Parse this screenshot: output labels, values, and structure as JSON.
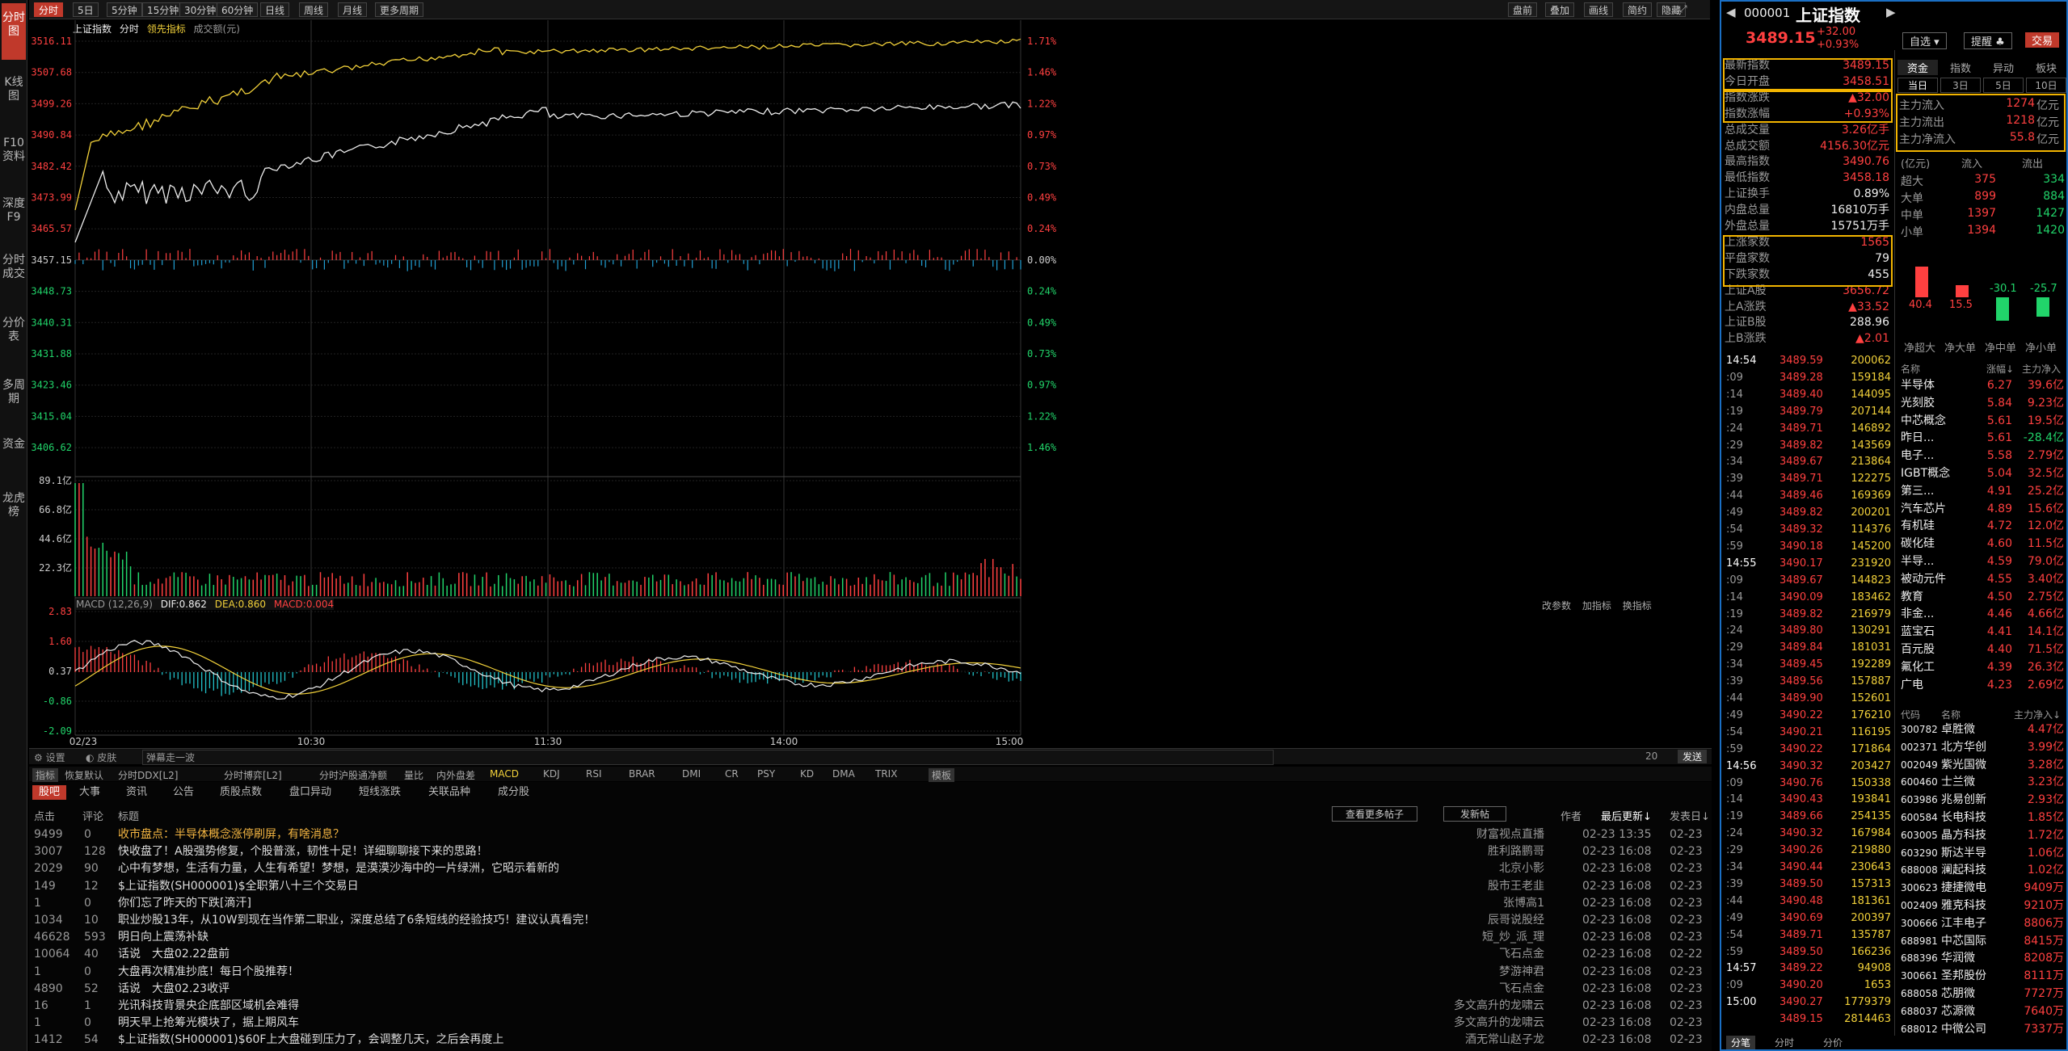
{
  "nav": [
    "分时图",
    "K线图",
    "F10资料",
    "深度F9",
    "分时成交",
    "分价表",
    "多周期",
    "资金",
    "龙虎榜"
  ],
  "toolbar": {
    "periods": [
      "分时",
      "5日",
      "5分钟",
      "15分钟",
      "30分钟",
      "60分钟",
      "日线",
      "周线",
      "月线",
      "更多周期"
    ],
    "right": [
      "盘前",
      "叠加",
      "画线",
      "简约",
      "隐藏"
    ]
  },
  "legend": {
    "name": "上证指数",
    "mode": "分时",
    "lead": "领先指标",
    "vol": "成交额(元)"
  },
  "yaxis": {
    "prices": [
      "3516.11",
      "3507.68",
      "3499.26",
      "3490.84",
      "3482.42",
      "3473.99",
      "3465.57",
      "3457.15",
      "3448.73",
      "3440.31",
      "3431.88",
      "3423.46",
      "3415.04",
      "3406.62"
    ],
    "pcts": [
      "1.71%",
      "1.46%",
      "1.22%",
      "0.97%",
      "0.73%",
      "0.49%",
      "0.24%",
      "0.00%",
      "0.24%",
      "0.49%",
      "0.73%",
      "0.97%",
      "1.22%",
      "1.46%"
    ],
    "vols": [
      "89.1亿",
      "66.8亿",
      "44.6亿",
      "22.3亿"
    ],
    "macd": [
      "2.83",
      "1.60",
      "0.37",
      "-0.86",
      "-2.09"
    ]
  },
  "xaxis": [
    "02/23",
    "10:30",
    "11:30",
    "14:00",
    "15:00"
  ],
  "macd": {
    "title": "MACD (12,26,9)",
    "dif": "DIF:0.862",
    "dea": "DEA:0.860",
    "macd": "MACD:0.004",
    "actions": [
      "改参数",
      "加指标",
      "换指标"
    ]
  },
  "bottomtabs": {
    "settings": "设置",
    "skin": "皮肤",
    "popup": "弹幕走一波",
    "count": "20",
    "send": "发送",
    "indicators": [
      "指标",
      "恢复默认",
      "分时DDX[L2]",
      "分时博弈[L2]",
      "分时沪股通净额",
      "量比",
      "内外盘差",
      "MACD",
      "KDJ",
      "RSI",
      "BRAR",
      "DMI",
      "CR",
      "PSY",
      "KD",
      "DMA",
      "TRIX",
      "模板"
    ]
  },
  "news": {
    "tabs": [
      "股吧",
      "大事",
      "资讯",
      "公告",
      "质股点数",
      "盘口异动",
      "短线涨跌",
      "关联品种",
      "成分股"
    ],
    "buttons": [
      "查看更多帖子",
      "发新帖"
    ],
    "headers": [
      "点击",
      "评论",
      "标题",
      "作者",
      "最后更新↓",
      "发表日↓"
    ],
    "rows": [
      [
        "9499",
        "0",
        "收市盘点：半导体概念涨停刷屏，有啥消息？",
        "财富视点直播",
        "02-23 13:35",
        "02-23"
      ],
      [
        "3007",
        "128",
        "快收盘了！A股强势修复，个股普涨，韧性十足！详细聊聊接下来的思路！",
        "胜利路鹏哥",
        "02-23 16:08",
        "02-23"
      ],
      [
        "2029",
        "90",
        "心中有梦想，生活有力量，人生有希望！梦想，是漠漠沙海中的一片绿洲，它昭示着新的",
        "北京小影",
        "02-23 16:08",
        "02-23"
      ],
      [
        "149",
        "12",
        "$上证指数(SH000001)$全职第八十三个交易日",
        "股市王老韭",
        "02-23 16:08",
        "02-23"
      ],
      [
        "1",
        "0",
        "你们忘了昨天的下跌[滴汗]",
        "张博高1",
        "02-23 16:08",
        "02-23"
      ],
      [
        "1034",
        "10",
        "职业炒股13年，从10W到现在当作第二职业，深度总结了6条短线的经验技巧！建议认真看完！",
        "辰哥说股经",
        "02-23 16:08",
        "02-23"
      ],
      [
        "46628",
        "593",
        "明日向上震荡补缺",
        "短_炒_派_理",
        "02-23 16:08",
        "02-23"
      ],
      [
        "10064",
        "40",
        "话说　大盘02.22盘前",
        "飞石点金",
        "02-23 16:08",
        "02-22"
      ],
      [
        "1",
        "0",
        "大盘再次精准抄底！每日个股推荐！",
        "梦游神君",
        "02-23 16:08",
        "02-23"
      ],
      [
        "4890",
        "52",
        "话说　大盘02.23收评",
        "飞石点金",
        "02-23 16:08",
        "02-23"
      ],
      [
        "16",
        "1",
        "光讯科技背景央企底部区域机会难得",
        "多文高升的龙啸云",
        "02-23 16:08",
        "02-23"
      ],
      [
        "1",
        "0",
        "明天早上抢筹光模块了，据上期风车",
        "多文高升的龙啸云",
        "02-23 16:08",
        "02-23"
      ],
      [
        "1412",
        "54",
        "$上证指数(SH000001)$60F上大盘碰到压力了，会调整几天，之后会再度上",
        "酒无常山赵子龙",
        "02-23 16:08",
        "02-23"
      ]
    ]
  },
  "quote": {
    "code": "000001",
    "name": "上证指数",
    "price": "3489.15",
    "chg": "+32.00",
    "pct": "+0.93%",
    "btn1": "自选",
    "btn2": "提醒",
    "btn3": "交易",
    "fields": [
      [
        "最新指数",
        "3489.15"
      ],
      [
        "今日开盘",
        "3458.51"
      ],
      [
        "指数涨跌",
        "▲32.00"
      ],
      [
        "指数涨幅",
        "+0.93%"
      ],
      [
        "总成交量",
        "3.26亿手"
      ],
      [
        "总成交额",
        "4156.30亿元"
      ],
      [
        "最高指数",
        "3490.76"
      ],
      [
        "最低指数",
        "3458.18"
      ],
      [
        "上证换手",
        "0.89%"
      ],
      [
        "内盘总量",
        "16810万手"
      ],
      [
        "外盘总量",
        "15751万手"
      ],
      [
        "上涨家数",
        "1565"
      ],
      [
        "平盘家数",
        "79"
      ],
      [
        "下跌家数",
        "455"
      ],
      [
        "上证A股",
        "3656.72"
      ],
      [
        "上A涨跌",
        "▲33.52"
      ],
      [
        "上证B股",
        "288.96"
      ],
      [
        "上B涨跌",
        "▲2.01"
      ]
    ],
    "fundtabs": [
      "资金",
      "指数",
      "异动",
      "板块"
    ],
    "fundsub": [
      "当日",
      "3日",
      "5日",
      "10日"
    ],
    "flow": [
      [
        "主力流入",
        "1274",
        "亿元"
      ],
      [
        "主力流出",
        "1218",
        "亿元"
      ],
      [
        "主力净流入",
        "55.8",
        "亿元"
      ]
    ],
    "flowhdr": [
      "(亿元)",
      "流入",
      "流出"
    ],
    "sizes": [
      [
        "超大",
        "375",
        "334"
      ],
      [
        "大单",
        "899",
        "884"
      ],
      [
        "中单",
        "1397",
        "1427"
      ],
      [
        "小单",
        "1394",
        "1420"
      ]
    ],
    "bars": [
      {
        "label": "净超大",
        "v": 40.4
      },
      {
        "label": "净大单",
        "v": 15.5
      },
      {
        "label": "净中单",
        "v": -30.1
      },
      {
        "label": "净小单",
        "v": -25.7
      }
    ],
    "sectorhdr": [
      "名称",
      "涨幅↓",
      "主力净入"
    ],
    "sectors": [
      [
        "半导体",
        "6.27",
        "39.6亿"
      ],
      [
        "光刻胶",
        "5.84",
        "9.23亿"
      ],
      [
        "中芯概念",
        "5.61",
        "19.5亿"
      ],
      [
        "昨日...",
        "5.61",
        "-28.4亿"
      ],
      [
        "电子...",
        "5.58",
        "2.79亿"
      ],
      [
        "IGBT概念",
        "5.04",
        "32.5亿"
      ],
      [
        "第三...",
        "4.91",
        "25.2亿"
      ],
      [
        "汽车芯片",
        "4.89",
        "15.6亿"
      ],
      [
        "有机硅",
        "4.72",
        "12.0亿"
      ],
      [
        "碳化硅",
        "4.60",
        "11.5亿"
      ],
      [
        "半导...",
        "4.59",
        "79.0亿"
      ],
      [
        "被动元件",
        "4.55",
        "3.40亿"
      ],
      [
        "教育",
        "4.50",
        "2.75亿"
      ],
      [
        "非金...",
        "4.46",
        "4.66亿"
      ],
      [
        "蓝宝石",
        "4.41",
        "14.1亿"
      ],
      [
        "百元股",
        "4.40",
        "71.5亿"
      ],
      [
        "氟化工",
        "4.39",
        "26.3亿"
      ],
      [
        "广电",
        "4.23",
        "2.69亿"
      ]
    ],
    "stockhdr": [
      "代码",
      "名称",
      "主力净入↓"
    ],
    "stocks": [
      [
        "300782",
        "卓胜微",
        "4.47亿"
      ],
      [
        "002371",
        "北方华创",
        "3.99亿"
      ],
      [
        "002049",
        "紫光国微",
        "3.28亿"
      ],
      [
        "600460",
        "士兰微",
        "3.23亿"
      ],
      [
        "603986",
        "兆易创新",
        "2.93亿"
      ],
      [
        "600584",
        "长电科技",
        "1.85亿"
      ],
      [
        "603005",
        "晶方科技",
        "1.72亿"
      ],
      [
        "603290",
        "斯达半导",
        "1.06亿"
      ],
      [
        "688008",
        "澜起科技",
        "1.02亿"
      ],
      [
        "300623",
        "捷捷微电",
        "9409万"
      ],
      [
        "002409",
        "雅克科技",
        "9210万"
      ],
      [
        "300666",
        "江丰电子",
        "8806万"
      ],
      [
        "688981",
        "中芯国际",
        "8415万"
      ],
      [
        "688396",
        "华润微",
        "8208万"
      ],
      [
        "300661",
        "圣邦股份",
        "8111万"
      ],
      [
        "688058",
        "芯朋微",
        "7727万"
      ],
      [
        "688037",
        "芯源微",
        "7640万"
      ],
      [
        "688012",
        "中微公司",
        "7337万"
      ]
    ],
    "ticks": [
      [
        "14:54",
        "3489.59",
        "200062"
      ],
      [
        ":09",
        "3489.28",
        "159184"
      ],
      [
        ":14",
        "3489.40",
        "144095"
      ],
      [
        ":19",
        "3489.79",
        "207144"
      ],
      [
        ":24",
        "3489.71",
        "146892"
      ],
      [
        ":29",
        "3489.82",
        "143569"
      ],
      [
        ":34",
        "3489.67",
        "213864"
      ],
      [
        ":39",
        "3489.71",
        "122275"
      ],
      [
        ":44",
        "3489.46",
        "169369"
      ],
      [
        ":49",
        "3489.82",
        "200201"
      ],
      [
        ":54",
        "3489.32",
        "114376"
      ],
      [
        ":59",
        "3490.18",
        "145200"
      ],
      [
        "14:55",
        "3490.17",
        "231920"
      ],
      [
        ":09",
        "3489.67",
        "144823"
      ],
      [
        ":14",
        "3490.09",
        "183462"
      ],
      [
        ":19",
        "3489.82",
        "216979"
      ],
      [
        ":24",
        "3489.80",
        "130291"
      ],
      [
        ":29",
        "3489.84",
        "181031"
      ],
      [
        ":34",
        "3489.45",
        "192289"
      ],
      [
        ":39",
        "3489.56",
        "157887"
      ],
      [
        ":44",
        "3489.90",
        "152601"
      ],
      [
        ":49",
        "3490.22",
        "176210"
      ],
      [
        ":54",
        "3490.21",
        "116195"
      ],
      [
        ":59",
        "3490.22",
        "171864"
      ],
      [
        "14:56",
        "3490.32",
        "203427"
      ],
      [
        ":09",
        "3490.76",
        "150338"
      ],
      [
        ":14",
        "3490.43",
        "193841"
      ],
      [
        ":19",
        "3489.66",
        "254135"
      ],
      [
        ":24",
        "3490.32",
        "167984"
      ],
      [
        ":29",
        "3490.26",
        "219880"
      ],
      [
        ":34",
        "3490.44",
        "230643"
      ],
      [
        ":39",
        "3489.50",
        "157313"
      ],
      [
        ":44",
        "3490.48",
        "181361"
      ],
      [
        ":49",
        "3490.69",
        "200397"
      ],
      [
        ":54",
        "3489.71",
        "135787"
      ],
      [
        ":59",
        "3489.50",
        "166236"
      ],
      [
        "14:57",
        "3489.22",
        "94908"
      ],
      [
        ":09",
        "3490.20",
        "1653"
      ],
      [
        "15:00",
        "3490.27",
        "1779379"
      ],
      [
        "",
        "3489.15",
        "2814463"
      ]
    ],
    "bottomtabs": [
      "分笔",
      "分时",
      "分价"
    ]
  }
}
